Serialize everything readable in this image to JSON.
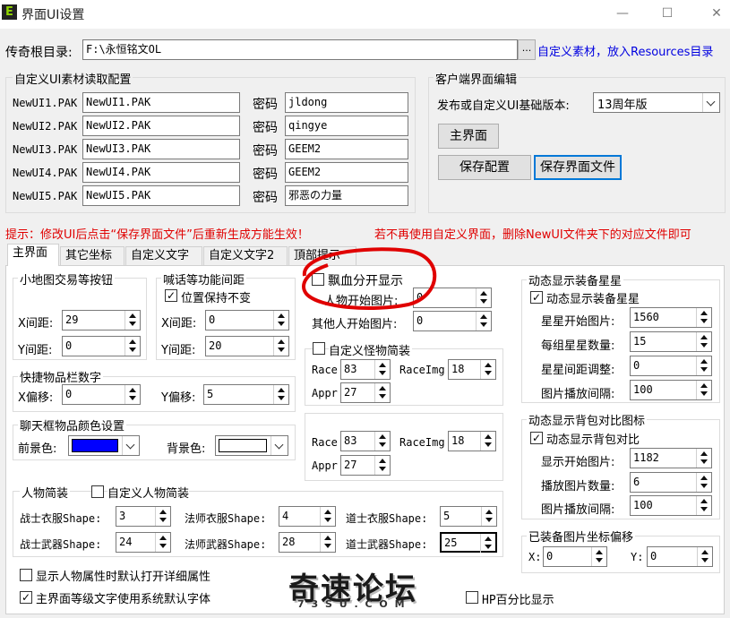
{
  "window": {
    "title": "界面UI设置",
    "icon": "E",
    "min": "—",
    "max": "☐",
    "close": "✕"
  },
  "root": {
    "label": "传奇根目录:",
    "value": "F:\\永恒铭文OL",
    "browse": "...",
    "hint": "自定义素材，放入Resources目录"
  },
  "pak": {
    "title": "自定义UI素材读取配置",
    "password_label": "密码",
    "rows": [
      {
        "label": "NewUI1.PAK",
        "file": "NewUI1.PAK",
        "password": "jldong"
      },
      {
        "label": "NewUI2.PAK",
        "file": "NewUI2.PAK",
        "password": "qingye"
      },
      {
        "label": "NewUI3.PAK",
        "file": "NewUI3.PAK",
        "password": "GEEM2"
      },
      {
        "label": "NewUI4.PAK",
        "file": "NewUI4.PAK",
        "password": "GEEM2"
      },
      {
        "label": "NewUI5.PAK",
        "file": "NewUI5.PAK",
        "password": "邪恶の力量"
      }
    ]
  },
  "client": {
    "title": "客户端界面编辑",
    "version_label": "发布或自定义UI基础版本:",
    "version_value": "13周年版",
    "main_button": "主界面",
    "save_config": "保存配置",
    "save_file": "保存界面文件"
  },
  "notice": {
    "left": "提示：修改UI后点击“保存界面文件”后重新生成方能生效！",
    "right": "若不再使用自定义界面，删除NewUI文件夹下的对应文件即可"
  },
  "tabs": [
    "主界面",
    "其它坐标",
    "自定义文字",
    "自定义文字2",
    "頂部提示"
  ],
  "minimap": {
    "title": "小地图交易等按钮",
    "x_label": "X间距:",
    "x": "29",
    "y_label": "Y间距:",
    "y": "0"
  },
  "shout": {
    "title": "喊话等功能间距",
    "keep_label": "位置保持不变",
    "keep_checked": true,
    "x_label": "X间距:",
    "x": "0",
    "y_label": "Y间距:",
    "y": "20"
  },
  "float": {
    "label": "飘血分开显示",
    "checked": false,
    "person_label": "人物开始图片:",
    "person": "0",
    "other_label": "其他人开始图片:",
    "other": "0"
  },
  "monster": {
    "label": "自定义怪物简装",
    "checked": false,
    "race_label": "Race",
    "race": "83",
    "raceimg_label": "RaceImg",
    "raceimg": "18",
    "appr_label": "Appr",
    "appr": "27"
  },
  "monster2": {
    "race_label": "Race",
    "race": "83",
    "raceimg_label": "RaceImg",
    "raceimg": "18",
    "appr_label": "Appr",
    "appr": "27"
  },
  "quick": {
    "title": "快捷物品栏数字",
    "x_label": "X偏移:",
    "x": "0",
    "y_label": "Y偏移:",
    "y": "5"
  },
  "chatcolor": {
    "title": "聊天框物品颜色设置",
    "fg_label": "前景色:",
    "fg_color": "#0000ff",
    "bg_label": "背景色:",
    "bg_color": "#ffffff"
  },
  "person": {
    "title": "人物简装",
    "custom_label": "自定义人物简装",
    "custom_checked": false,
    "warrior_cloth_label": "战士衣服Shape:",
    "warrior_cloth": "3",
    "mage_cloth_label": "法师衣服Shape:",
    "mage_cloth": "4",
    "taoist_cloth_label": "道士衣服Shape:",
    "taoist_cloth": "5",
    "warrior_weapon_label": "战士武器Shape:",
    "warrior_weapon": "24",
    "mage_weapon_label": "法师武器Shape:",
    "mage_weapon": "28",
    "taoist_weapon_label": "道士武器Shape:",
    "taoist_weapon": "25"
  },
  "bottom": {
    "detail_label": "显示人物属性时默认打开详细属性",
    "detail_checked": false,
    "font_label": "主界面等级文字使用系统默认字体",
    "font_checked": true,
    "hp_label": "HP百分比显示",
    "hp_checked": false
  },
  "stars": {
    "title": "动态显示装备星星",
    "check_label": "动态显示装备星星",
    "checked": true,
    "start_label": "星星开始图片:",
    "start": "1560",
    "count_label": "每组星星数量:",
    "count": "15",
    "gap_label": "星星间距调整:",
    "gap": "0",
    "interval_label": "图片播放间隔:",
    "interval": "100"
  },
  "bag": {
    "title": "动态显示背包对比图标",
    "check_label": "动态显示背包对比",
    "checked": true,
    "start_label": "显示开始图片:",
    "start": "1182",
    "count_label": "播放图片数量:",
    "count": "6",
    "interval_label": "图片播放间隔:",
    "interval": "100"
  },
  "offset": {
    "title": "已装备图片坐标偏移",
    "x_label": "X:",
    "x": "0",
    "y_label": "Y:",
    "y": "0"
  },
  "watermark": {
    "text": "奇速论坛",
    "sub": "7 3 S U . C O M"
  },
  "colors": {
    "red": "#e00000",
    "circle": "#e00000"
  }
}
